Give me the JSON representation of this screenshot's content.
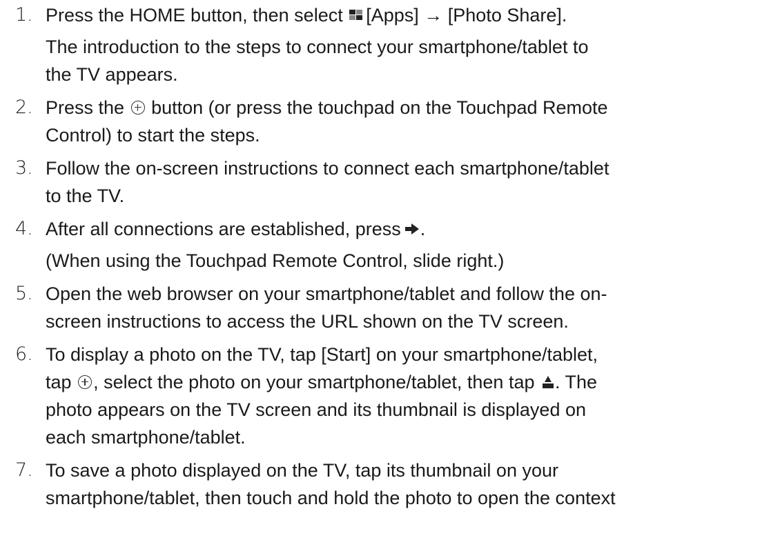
{
  "steps": [
    {
      "number": "1.",
      "lines": [
        "Press the HOME button, then select",
        "[Apps] → [Photo Share]."
      ],
      "sub": [
        "The introduction to the steps to connect your smartphone/tablet to",
        "the TV appears."
      ]
    },
    {
      "number": "2.",
      "lines": [
        "Press the",
        "button (or press the touchpad on the Touchpad Remote",
        "Control) to start the steps."
      ]
    },
    {
      "number": "3.",
      "lines": [
        "Follow the on-screen instructions to connect each smartphone/tablet",
        "to the TV."
      ]
    },
    {
      "number": "4.",
      "lines": [
        "After all connections are established, press",
        "."
      ],
      "sub": [
        "(When using the Touchpad Remote Control, slide right.)"
      ]
    },
    {
      "number": "5.",
      "lines": [
        "Open the web browser on your smartphone/tablet and follow the on-",
        "screen instructions to access the URL shown on the TV screen."
      ]
    },
    {
      "number": "6.",
      "lines": [
        "To display a photo on the TV, tap [Start] on your smartphone/tablet,",
        "tap",
        ", select the photo on your smartphone/tablet, then tap",
        ". The",
        "photo appears on the TV screen and its thumbnail is displayed on",
        "each smartphone/tablet."
      ]
    },
    {
      "number": "7.",
      "lines": [
        "To save a photo displayed on the TV, tap its thumbnail on your",
        "smartphone/tablet, then touch and hold the photo to open the context"
      ]
    }
  ],
  "icons": {
    "apps": "apps-icon",
    "enter": "enter-button-icon",
    "right_arrow": "right-arrow-icon",
    "upload": "upload-icon"
  }
}
